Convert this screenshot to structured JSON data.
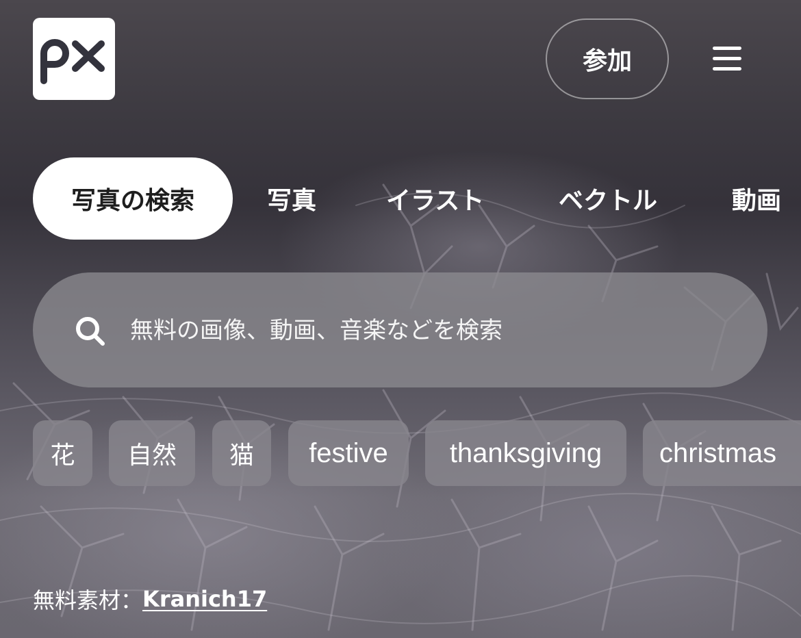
{
  "header": {
    "logo_text": "px",
    "join_label": "参加",
    "menu_icon": "hamburger-menu-icon"
  },
  "tabs": [
    {
      "label": "写真の検索",
      "active": true
    },
    {
      "label": "写真",
      "active": false
    },
    {
      "label": "イラスト",
      "active": false
    },
    {
      "label": "ベクトル",
      "active": false
    },
    {
      "label": "動画",
      "active": false
    }
  ],
  "search": {
    "placeholder": "無料の画像、動画、音楽などを検索",
    "icon": "search-icon"
  },
  "chips": [
    "花",
    "自然",
    "猫",
    "festive",
    "thanksgiving",
    "christmas"
  ],
  "credit": {
    "prefix": "無料素材：",
    "author": "Kranich17"
  },
  "colors": {
    "active_tab_bg": "#ffffff",
    "active_tab_text": "#1e1e1e",
    "logo_mark": "#33333d"
  }
}
